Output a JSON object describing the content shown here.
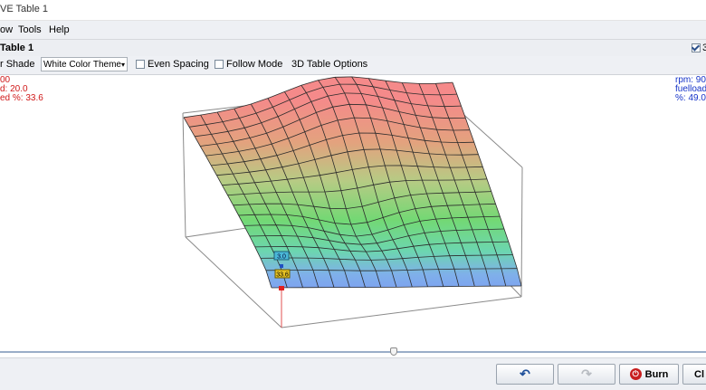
{
  "window": {
    "title": "VE Table 1"
  },
  "menu": {
    "items": [
      "ow",
      "Tools",
      "Help"
    ]
  },
  "panel": {
    "title": "Table 1",
    "toggle_3d_label": "3"
  },
  "toolbar": {
    "shade_label": "r Shade",
    "color_theme": "White Color Theme",
    "even_spacing_label": "Even Spacing",
    "follow_mode_label": "Follow Mode",
    "table_options_label": "3D Table Options"
  },
  "readout_left": {
    "line1": "00",
    "line2": "d: 20.0",
    "line3": "ed %: 33.6"
  },
  "readout_right": {
    "line1": "rpm: 90",
    "line2": "fuelload",
    "line3": "%: 49.0"
  },
  "cursor_marker": {
    "top_value": "3.0",
    "bottom_value": "33.6"
  },
  "buttons": {
    "undo_icon": "undo-icon",
    "redo_icon": "redo-icon",
    "burn_label": "Burn",
    "close_label": "Cl"
  },
  "colors": {
    "surface_low": "#7d9ef2",
    "surface_mid": "#6fd870",
    "surface_high": "#f58a8a",
    "readout_left": "#d01818",
    "readout_right": "#1432c8"
  }
}
